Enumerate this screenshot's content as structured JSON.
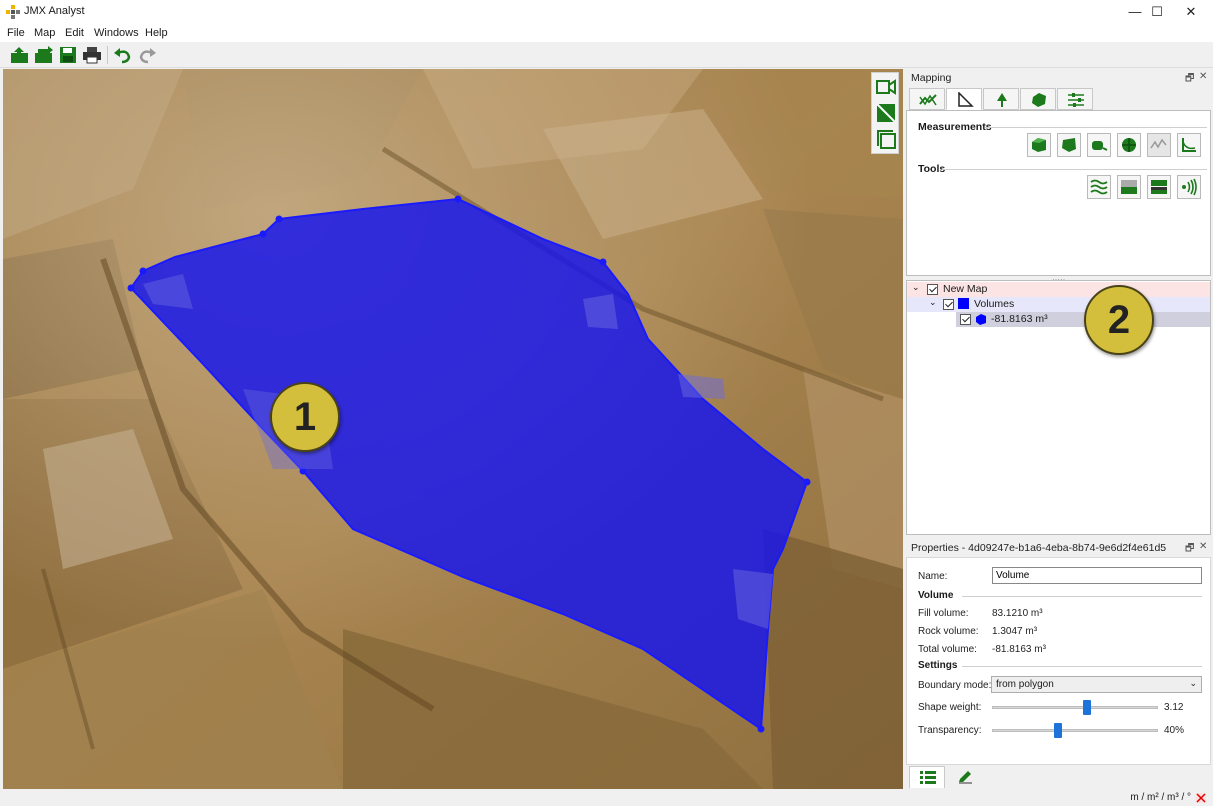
{
  "window": {
    "title": "JMX Analyst",
    "minimize_glyph": "—",
    "maximize_glyph": "☐",
    "close_glyph": "✕"
  },
  "menu": [
    {
      "label": "File"
    },
    {
      "label": "Map"
    },
    {
      "label": "Edit"
    },
    {
      "label": "Windows"
    },
    {
      "label": "Help"
    }
  ],
  "toolbar": {
    "icons": [
      "open-icon",
      "import-icon",
      "save-icon",
      "print-icon",
      "undo-icon",
      "redo-icon"
    ]
  },
  "viewport": {
    "polygon_color": "#1010e8",
    "callouts": [
      {
        "label": "1"
      },
      {
        "label": "2"
      }
    ]
  },
  "mapping_panel": {
    "title": "Mapping",
    "float_glyph": "🗗",
    "close_glyph": "✕",
    "tabs": [
      "profile-icon",
      "measure-icon",
      "tree-icon",
      "rock-icon",
      "settings-icon"
    ],
    "measurements_label": "Measurements",
    "measurements_buttons": [
      "volume-icon",
      "area-icon",
      "distance-icon",
      "sphere-icon",
      "profile-line-icon",
      "angle-icon"
    ],
    "tools_label": "Tools",
    "tools_buttons": [
      "contour-icon",
      "plane-icon",
      "slice-icon",
      "signal-icon"
    ],
    "splitter_glyph": "·····"
  },
  "layer_tree": {
    "items": [
      {
        "label": "New Map",
        "color": "#ff4d4d"
      },
      {
        "label": "Volumes",
        "color": "#0000ff"
      },
      {
        "label": "-81.8163 m³",
        "color": "#0000ff"
      }
    ]
  },
  "properties_panel": {
    "title": "Properties - 4d09247e-b1a6-4eba-8b74-9e6d2f4e61d5",
    "float_glyph": "🗗",
    "close_glyph": "✕",
    "name_label": "Name:",
    "name_value": "Volume",
    "volume_section": "Volume",
    "fill_label": "Fill volume:",
    "fill_value": "83.1210 m³",
    "rock_label": "Rock volume:",
    "rock_value": "1.3047 m³",
    "total_label": "Total volume:",
    "total_value": "-81.8163 m³",
    "settings_section": "Settings",
    "boundary_label": "Boundary mode:",
    "boundary_value": "from polygon",
    "shape_label": "Shape weight:",
    "shape_value": "3.12",
    "shape_fraction": 0.57,
    "transparency_label": "Transparency:",
    "transparency_value": "40%",
    "transparency_fraction": 0.4
  },
  "bottom_tabs": [
    "layers-list-icon",
    "edit-pen-icon"
  ],
  "status": {
    "units": "m / m² / m³ / °"
  }
}
